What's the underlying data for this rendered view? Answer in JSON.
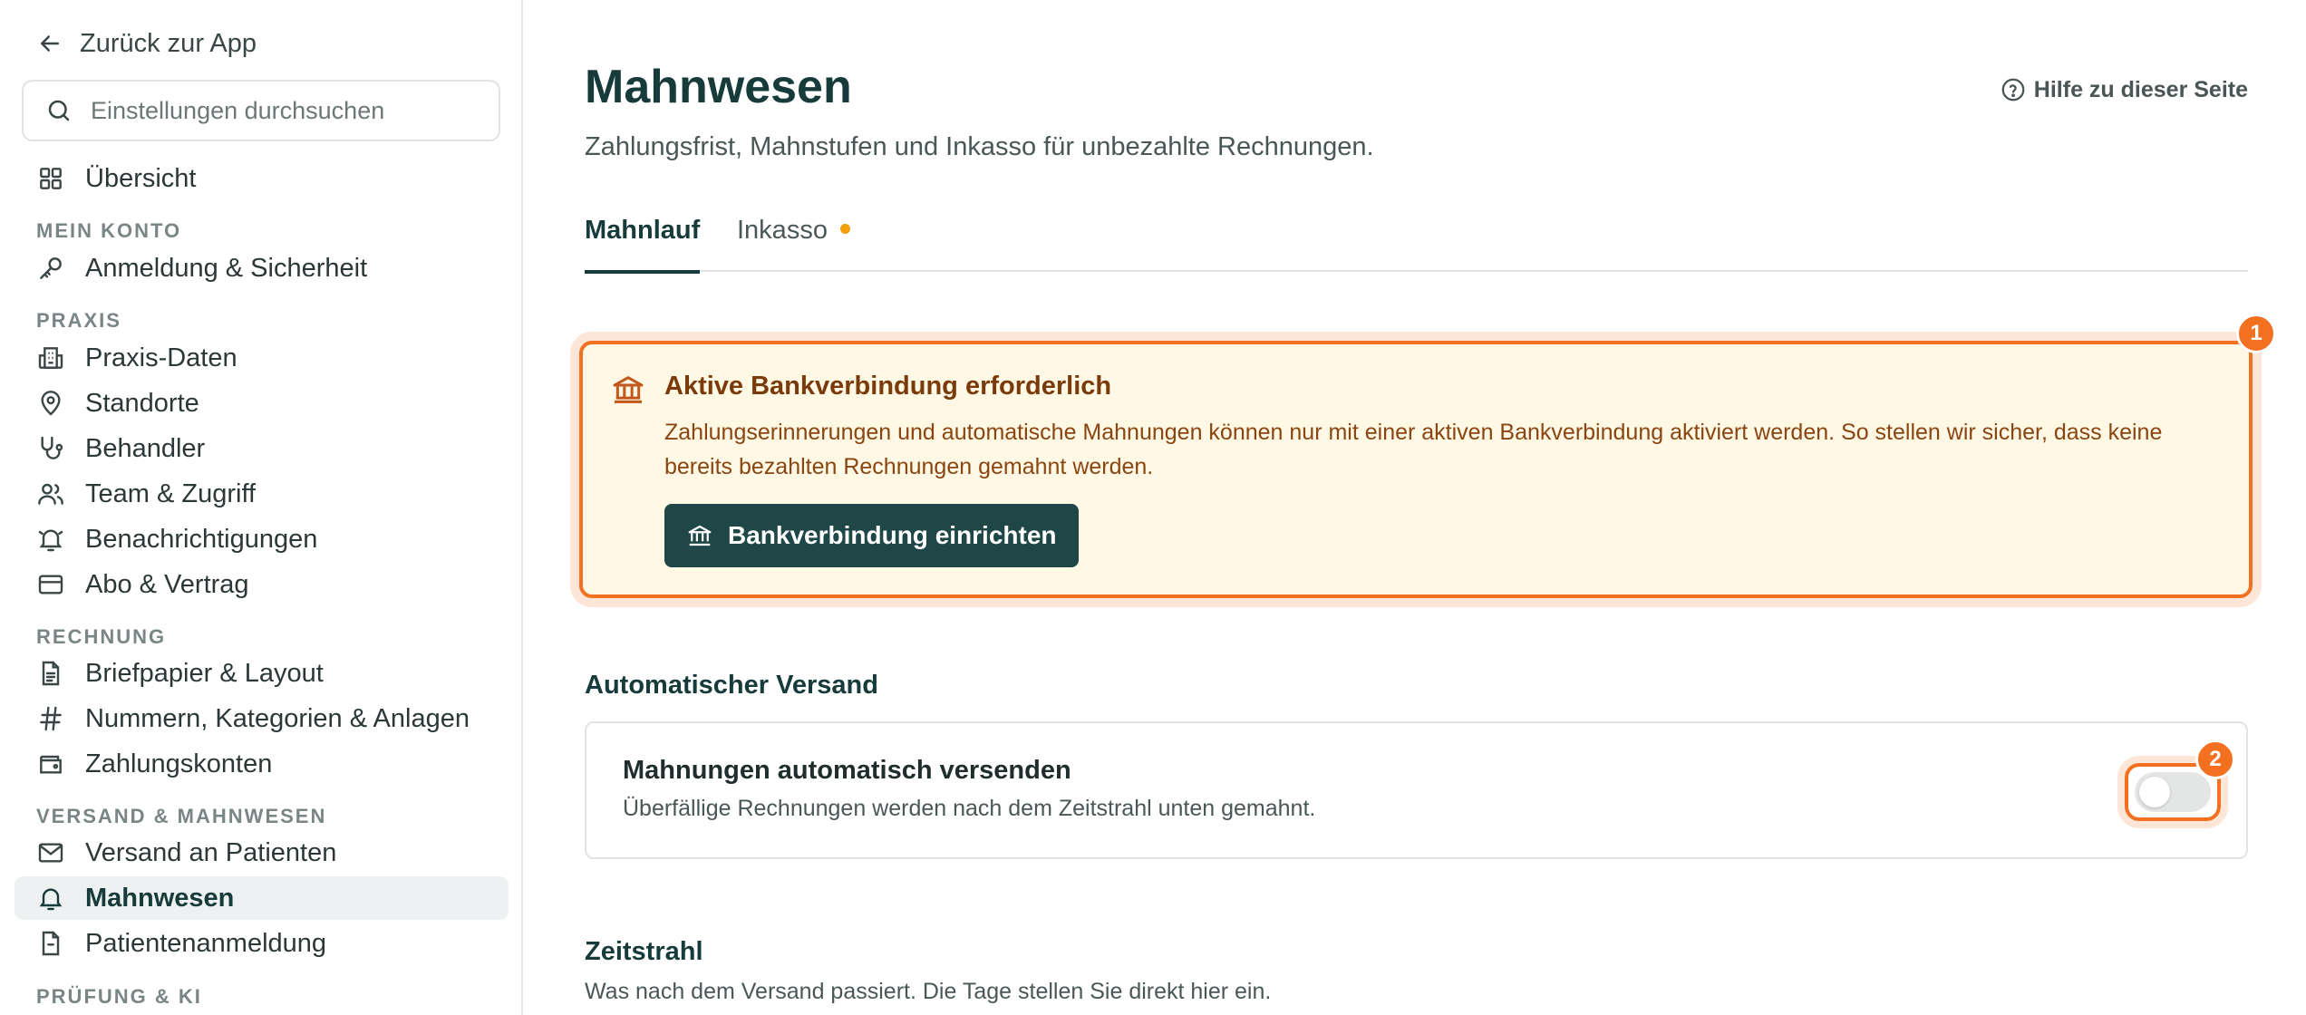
{
  "sidebar": {
    "back_label": "Zurück zur App",
    "search_placeholder": "Einstellungen durchsuchen",
    "overview": "Übersicht",
    "sections": {
      "account": "MEIN KONTO",
      "practice": "PRAXIS",
      "billing": "RECHNUNG",
      "dispatch": "VERSAND & MAHNWESEN",
      "review": "PRÜFUNG & KI"
    },
    "items": {
      "login": "Anmeldung & Sicherheit",
      "practice_data": "Praxis-Daten",
      "locations": "Standorte",
      "practitioners": "Behandler",
      "team": "Team & Zugriff",
      "notifications": "Benachrichtigungen",
      "subscription": "Abo & Vertrag",
      "letterhead": "Briefpapier & Layout",
      "numbers": "Nummern, Kategorien & Anlagen",
      "payment_accounts": "Zahlungskonten",
      "patient_dispatch": "Versand an Patienten",
      "dunning": "Mahnwesen",
      "patient_registration": "Patientenanmeldung"
    }
  },
  "main": {
    "title": "Mahnwesen",
    "help_label": "Hilfe zu dieser Seite",
    "subtitle": "Zahlungsfrist, Mahnstufen und Inkasso für unbezahlte Rechnungen.",
    "tabs": {
      "run": "Mahnlauf",
      "collection": "Inkasso"
    },
    "alert": {
      "title": "Aktive Bankverbindung erforderlich",
      "body": "Zahlungserinnerungen und automatische Mahnungen können nur mit einer aktiven Bankverbindung aktiviert werden. So stellen wir sicher, dass keine bereits bezahlten Rechnungen gemahnt werden.",
      "button": "Bankverbindung einrichten",
      "badge": "1"
    },
    "auto": {
      "heading": "Automatischer Versand",
      "card_title": "Mahnungen automatisch versenden",
      "card_sub": "Überfällige Rechnungen werden nach dem Zeitstrahl unten gemahnt.",
      "toggle_on": false,
      "badge": "2"
    },
    "timeline": {
      "heading": "Zeitstrahl",
      "sub": "Was nach dem Versand passiert. Die Tage stellen Sie direkt hier ein."
    }
  },
  "colors": {
    "brand": "#173a3a",
    "button": "#1f4747",
    "highlight": "#f2701f",
    "alert_bg": "#fff8e5",
    "tab_dot": "#f59e0b"
  }
}
